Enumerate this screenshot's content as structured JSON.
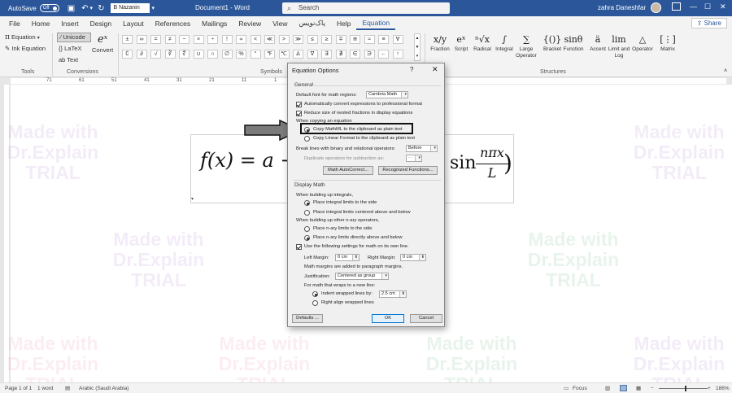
{
  "titlebar": {
    "autosave_label": "AutoSave",
    "autosave_state": "Off",
    "font_name": "B Nazanin",
    "doc_title": "Document1 - Word",
    "search_placeholder": "Search",
    "user_name": "zahra Daneshfar"
  },
  "menu": [
    "File",
    "Home",
    "Insert",
    "Design",
    "Layout",
    "References",
    "Mailings",
    "Review",
    "View",
    "پاک‌نویس",
    "Help",
    "Equation"
  ],
  "active_menu": "Equation",
  "share_label": "Share",
  "ribbon": {
    "tools": {
      "equation": "Equation",
      "ink_equation": "Ink Equation",
      "label": "Tools"
    },
    "conversions": {
      "unicode": "Unicode",
      "latex": "LaTeX",
      "text": "Text",
      "convert": "Convert",
      "label": "Conversions"
    },
    "symbols_label": "Symbols",
    "symbols_row1": [
      "±",
      "∞",
      "=",
      "≠",
      "~",
      "×",
      "÷",
      "!",
      "∝",
      "<",
      "≪",
      ">",
      "≫",
      "≤",
      "≥",
      "∓",
      "≅",
      "≈",
      "≡",
      "∀"
    ],
    "symbols_row2": [
      "∁",
      "∂",
      "√",
      "∛",
      "∜",
      "∪",
      "∩",
      "∅",
      "%",
      "°",
      "℉",
      "℃",
      "∆",
      "∇",
      "∃",
      "∄",
      "∈",
      "∋",
      "←",
      "↑"
    ],
    "structures_label": "Structures",
    "structures": [
      {
        "glyph": "x/y",
        "label": "Fraction"
      },
      {
        "glyph": "eˣ",
        "label": "Script"
      },
      {
        "glyph": "ⁿ√x",
        "label": "Radical"
      },
      {
        "glyph": "∫",
        "label": "Integral"
      },
      {
        "glyph": "∑",
        "label": "Large Operator"
      },
      {
        "glyph": "{()}",
        "label": "Bracket"
      },
      {
        "glyph": "sinθ",
        "label": "Function"
      },
      {
        "glyph": "ä",
        "label": "Accent"
      },
      {
        "glyph": "lim",
        "label": "Limit and Log"
      },
      {
        "glyph": "△",
        "label": "Operator"
      },
      {
        "glyph": "[⋮]",
        "label": "Matrix"
      }
    ]
  },
  "ruler_numbers": [
    "71",
    "61",
    "51",
    "41",
    "31",
    "21",
    "11",
    "1"
  ],
  "equation": {
    "left": "f(x) = a  +",
    "right": "sin",
    "numerator": "nπx",
    "denominator": "L",
    "rparen": ")"
  },
  "watermark": {
    "line1": "Made with",
    "line2": "Dr.Explain",
    "line3": "TRIAL"
  },
  "dialog": {
    "title": "Equation Options",
    "help": "?",
    "close": "✕",
    "general": "General",
    "default_font_label": "Default font for math regions:",
    "default_font_value": "Cambria Math",
    "auto_convert": "Automatically convert expressions to professional format",
    "reduce_size": "Reduce size of nested fractions in display equations",
    "when_copying": "When copying an equation",
    "copy_mathml": "Copy MathML to the clipboard as plain text",
    "copy_linear": "Copy Linear Format to the clipboard as plain text",
    "break_lines_label": "Break lines with binary and relational operators:",
    "break_lines_value": "Before",
    "duplicate_label": "Duplicate operators for subtraction as:",
    "duplicate_value": "- -",
    "autocorrect_btn": "Math AutoCorrect...",
    "recognized_btn": "Recognized Functions...",
    "display_math": "Display Math",
    "integrals_label": "When building up integrals,",
    "integrals_side": "Place integral limits to the side",
    "integrals_centered": "Place integral limits centered above and below",
    "nary_label": "When building up other n-ary operators,",
    "nary_side": "Place n-ary limits to the side",
    "nary_above": "Place n-ary limits directly above and below",
    "use_settings": "Use the following settings for math on its own line.",
    "left_margin_label": "Left Margin:",
    "left_margin_value": "0 cm",
    "right_margin_label": "Right Margin:",
    "right_margin_value": "0 cm",
    "margins_note": "Math margins are added to paragraph margins.",
    "justification_label": "Justification:",
    "justification_value": "Centered as group",
    "wraps_label": "For math that wraps to a new line:",
    "indent_label": "Indent wrapped lines by:",
    "indent_value": "2.5 cm",
    "right_align_label": "Right align wrapped lines",
    "defaults_btn": "Defaults ...",
    "ok_btn": "OK",
    "cancel_btn": "Cancel"
  },
  "status": {
    "page": "Page 1 of 1",
    "words": "1 word",
    "language": "Arabic (Saudi Arabia)",
    "focus": "Focus",
    "zoom": "186%"
  },
  "colors": {
    "accent": "#2b579a",
    "titlebar": "#2b579a"
  }
}
